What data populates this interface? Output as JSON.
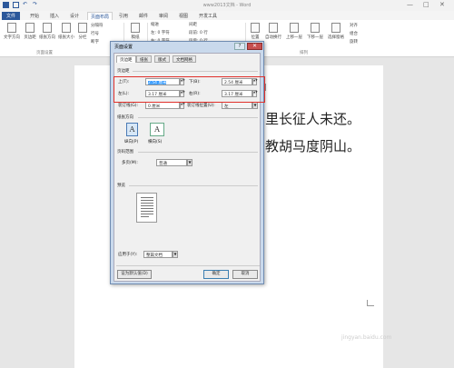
{
  "window": {
    "title": "www2013文档 - Word",
    "minimize": "—",
    "maximize": "□",
    "close": "✕"
  },
  "ribbon_tabs": [
    "文件",
    "开始",
    "插入",
    "设计",
    "页面布局",
    "引用",
    "邮件",
    "审阅",
    "视图",
    "开发工具"
  ],
  "ribbon": {
    "text_direction": "文字方向",
    "margins": "页边距",
    "orientation": "纸张方向",
    "size": "纸张大小",
    "columns": "分栏",
    "breaks": "分隔符",
    "line_numbers": "行号",
    "hyphenation": "断字",
    "page_setup_group": "页面设置",
    "indent_label": "缩进",
    "spacing_label": "间距",
    "indent_left": "左: 0 字符",
    "indent_right": "右: 0 字符",
    "spacing_before": "段前: 0 行",
    "spacing_after": "段后: 0 行",
    "position": "位置",
    "wrap": "自动换行",
    "bring_forward": "上移一层",
    "send_backward": "下移一层",
    "selection_pane": "选择窗格",
    "align": "对齐",
    "group": "组合",
    "rotate": "旋转",
    "arrange_group": "排列",
    "manuscript": "稿纸",
    "manuscript_settings": "稿纸设置"
  },
  "document": {
    "line1": "里长征人未还。",
    "line2": "教胡马度阴山。"
  },
  "dialog": {
    "title": "页面设置",
    "help": "?",
    "close": "✕",
    "tabs": [
      "页边距",
      "纸张",
      "版式",
      "文档网格"
    ],
    "margins_section": "页边距",
    "top_label": "上(T):",
    "top_value": "2.54 厘米",
    "bottom_label": "下(B):",
    "bottom_value": "2.54 厘米",
    "left_label": "左(L):",
    "left_value": "3.17 厘米",
    "right_label": "右(R):",
    "right_value": "3.17 厘米",
    "gutter_label": "装订线(G):",
    "gutter_value": "0 厘米",
    "gutter_pos_label": "装订线位置(U):",
    "gutter_pos_value": "左",
    "orientation_section": "纸张方向",
    "portrait": "纵向(P)",
    "landscape": "横向(S)",
    "pages_section": "页码范围",
    "multiple_pages_label": "多页(M):",
    "multiple_pages_value": "普通",
    "preview_section": "预览",
    "apply_to_label": "应用于(Y):",
    "apply_to_value": "整篇文档",
    "set_default": "设为默认值(D)",
    "ok": "确定",
    "cancel": "取消"
  },
  "watermark": "jingyan.baidu.com"
}
